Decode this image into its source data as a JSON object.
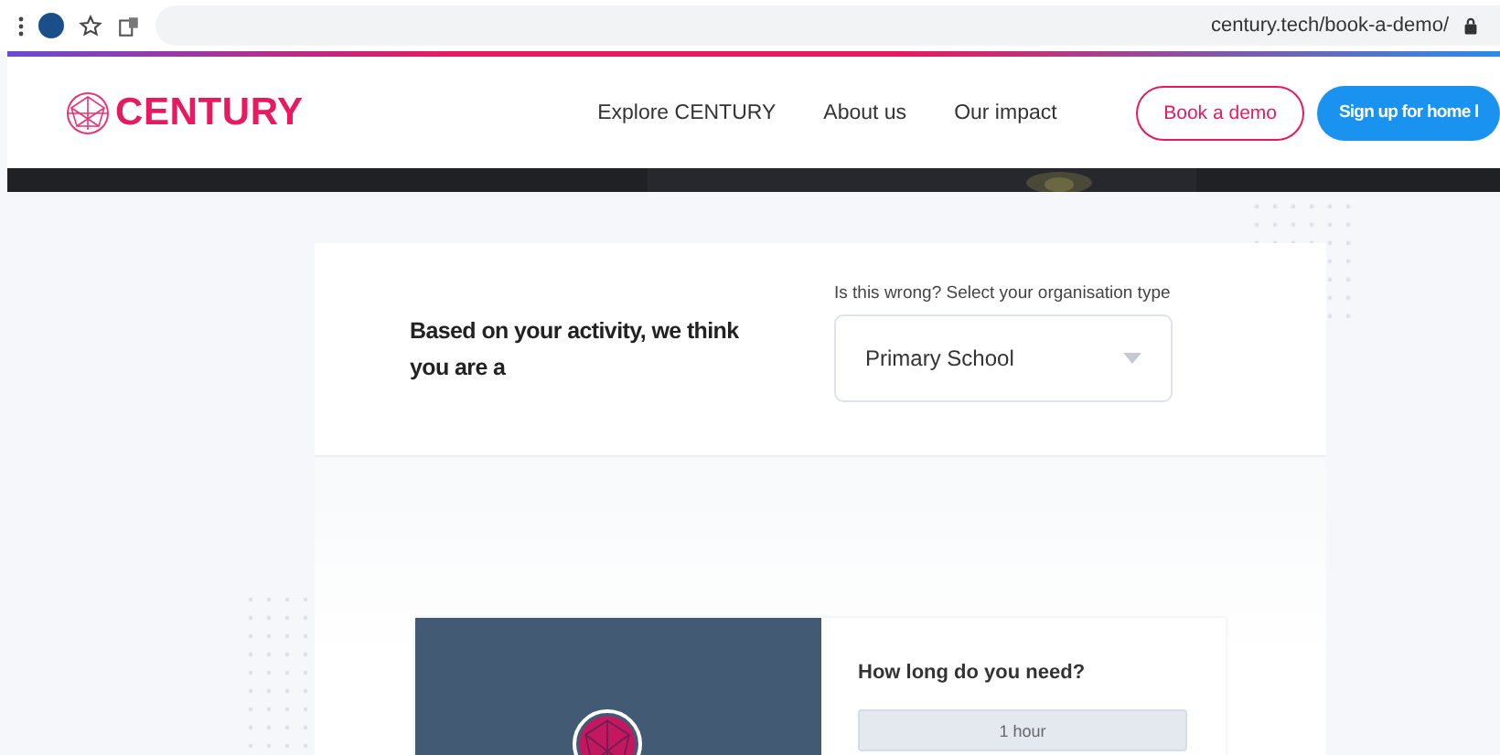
{
  "browser": {
    "url": "century.tech/book-a-demo/"
  },
  "nav": {
    "brand": "CENTURY",
    "links": [
      "Explore CENTURY",
      "About us",
      "Our impact"
    ],
    "buttons": [
      {
        "label": "Book a demo",
        "kind": "outline"
      },
      {
        "label": "Sign up for home l",
        "kind": "filled"
      }
    ]
  },
  "organisation": {
    "heading": "Based on your activity, we think you are a",
    "select_label": "Is this wrong? Select your organisation type",
    "select": {
      "value": "Primary School"
    }
  },
  "booking": {
    "heading": "How long do you need?",
    "options": [
      {
        "label": "1 hour",
        "selected": false
      }
    ]
  }
}
